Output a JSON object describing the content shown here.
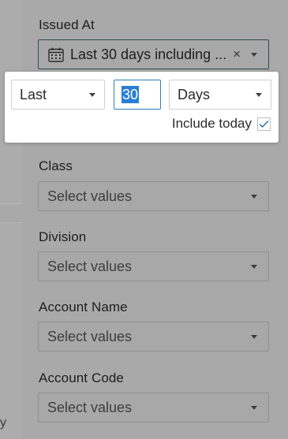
{
  "background": {
    "corner_text": "y"
  },
  "issued_at": {
    "label": "Issued At",
    "value": "Last 30 days including ...",
    "clear_symbol": "×"
  },
  "date_popup": {
    "period": "Last",
    "amount": "30",
    "unit": "Days",
    "include_today_label": "Include today",
    "include_today_checked": true
  },
  "filters": [
    {
      "label": "Class",
      "placeholder": "Select values"
    },
    {
      "label": "Division",
      "placeholder": "Select values"
    },
    {
      "label": "Account Name",
      "placeholder": "Select values"
    },
    {
      "label": "Account Code",
      "placeholder": "Select values"
    }
  ],
  "colors": {
    "overlay_bg": "#a9a9a9",
    "selection_highlight": "#2a7fd4",
    "check_color": "#2a6fb0"
  }
}
